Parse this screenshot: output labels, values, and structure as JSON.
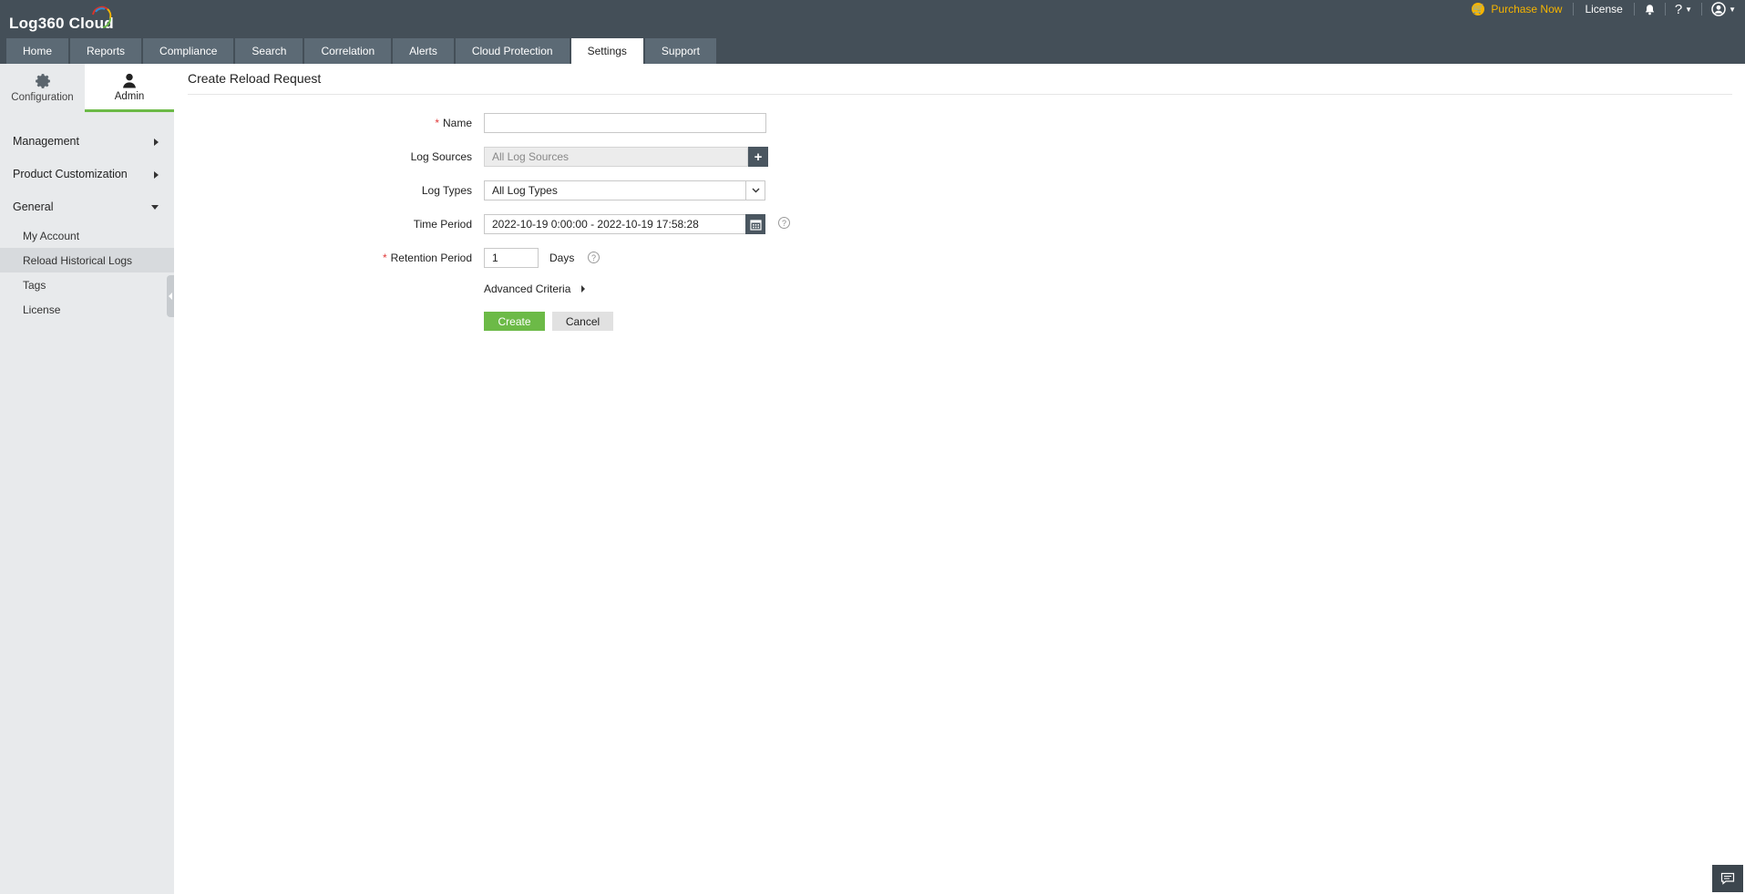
{
  "app": {
    "logo_text": "Log360  Cloud"
  },
  "top_right": {
    "purchase": "Purchase Now",
    "license": "License",
    "help": "?"
  },
  "tabs": [
    {
      "label": "Home"
    },
    {
      "label": "Reports"
    },
    {
      "label": "Compliance"
    },
    {
      "label": "Search"
    },
    {
      "label": "Correlation"
    },
    {
      "label": "Alerts"
    },
    {
      "label": "Cloud Protection"
    },
    {
      "label": "Settings",
      "active": true
    },
    {
      "label": "Support"
    }
  ],
  "sidebar": {
    "subtabs": [
      {
        "label": "Configuration"
      },
      {
        "label": "Admin",
        "active": true
      }
    ],
    "groups": [
      {
        "label": "Management"
      },
      {
        "label": "Product Customization"
      },
      {
        "label": "General"
      }
    ],
    "items": [
      {
        "label": "My Account"
      },
      {
        "label": "Reload Historical Logs",
        "active": true
      },
      {
        "label": "Tags"
      },
      {
        "label": "License"
      }
    ]
  },
  "form": {
    "title": "Create Reload Request",
    "name": {
      "label": "Name",
      "value": ""
    },
    "log_sources": {
      "label": "Log Sources",
      "value": "All Log Sources"
    },
    "log_types": {
      "label": "Log Types",
      "value": "All Log Types"
    },
    "time_period": {
      "label": "Time Period",
      "value": "2022-10-19 0:00:00 - 2022-10-19 17:58:28"
    },
    "retention": {
      "label": "Retention Period",
      "value": "1",
      "unit": "Days"
    },
    "advanced": "Advanced Criteria",
    "create": "Create",
    "cancel": "Cancel"
  },
  "colors": {
    "topbar": "#444f58",
    "accent_green": "#6cba47",
    "purchase": "#f5b400"
  }
}
